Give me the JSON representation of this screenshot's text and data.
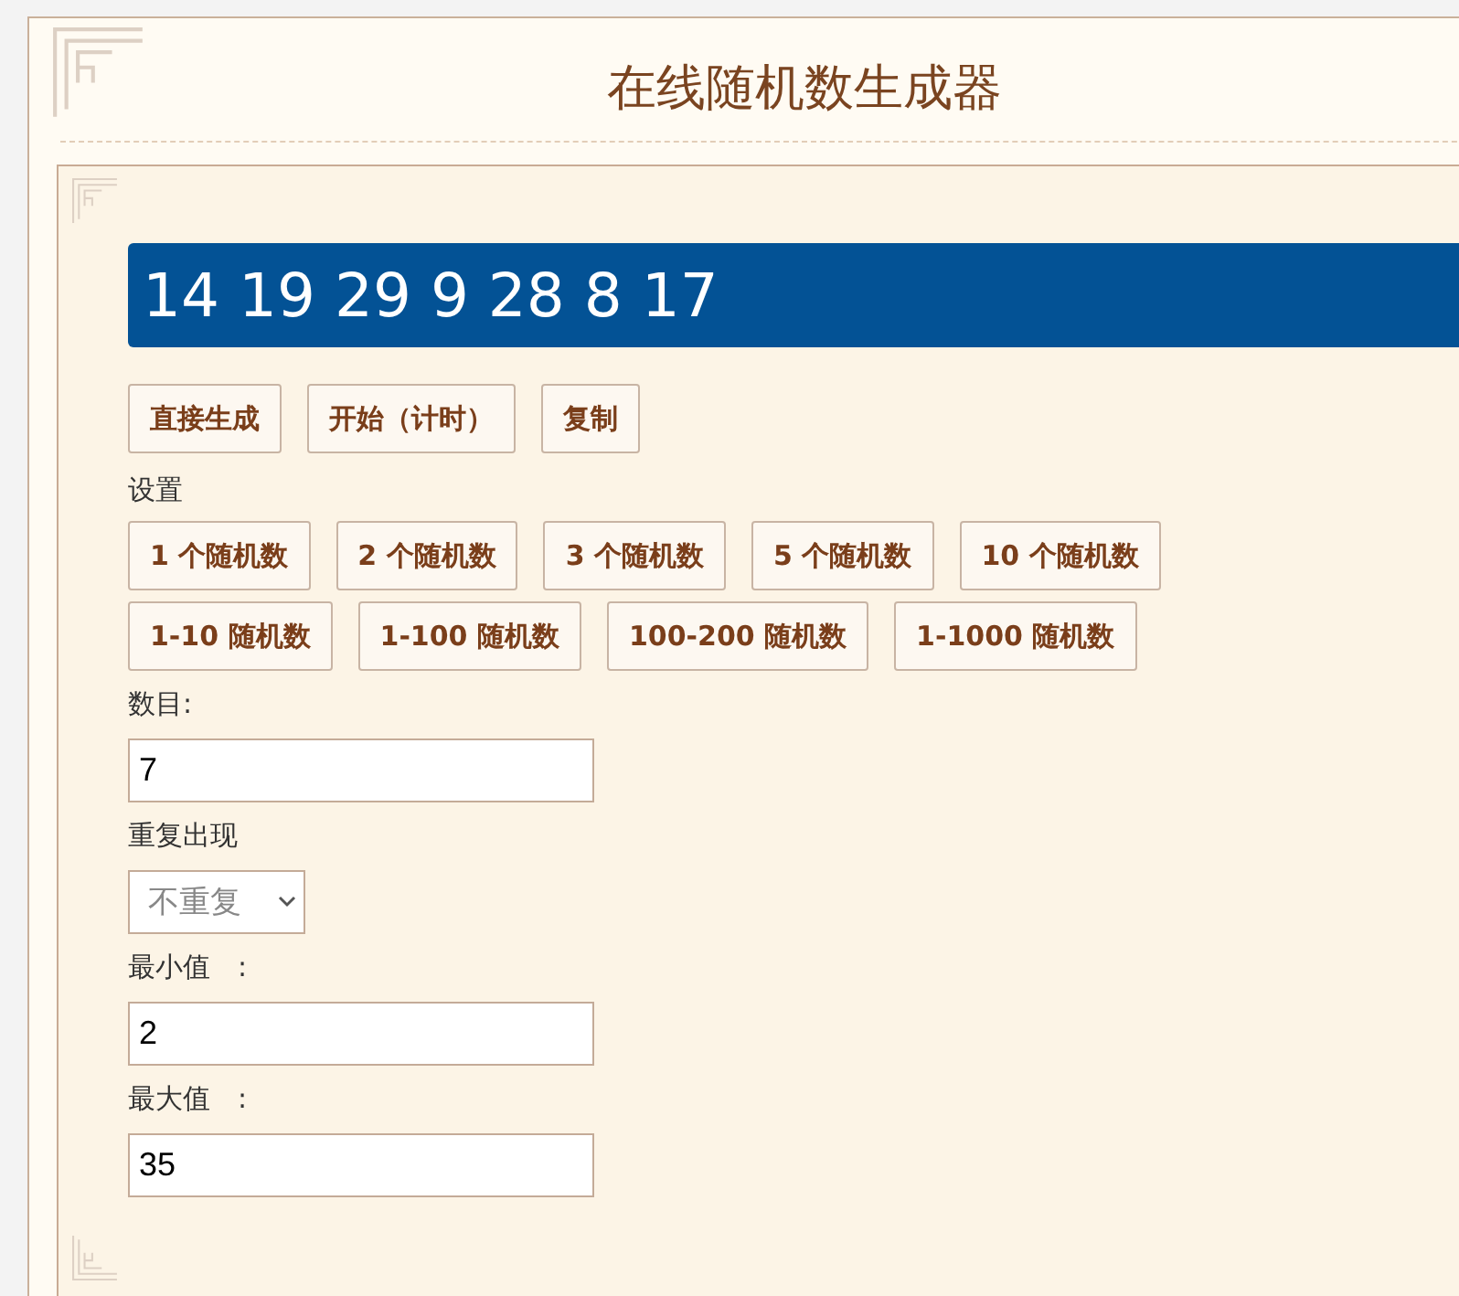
{
  "title": "在线随机数生成器",
  "result": "14 19 29 9 28 8 17",
  "actions": [
    "直接生成",
    "开始（计时）",
    "复制"
  ],
  "settings_label": "设置",
  "preset_rows": [
    [
      "1 个随机数",
      "2 个随机数",
      "3 个随机数",
      "5 个随机数",
      "10 个随机数"
    ],
    [
      "1-10 随机数",
      "1-100 随机数",
      "100-200 随机数",
      "1-1000 随机数"
    ]
  ],
  "fields": [
    {
      "kind": "text",
      "label": "数目:",
      "value": "7"
    },
    {
      "kind": "select",
      "label": "重复出现",
      "value": "不重复"
    },
    {
      "kind": "text",
      "label": "最小值　:",
      "value": "2"
    },
    {
      "kind": "text",
      "label": "最大值　:",
      "value": "35"
    }
  ]
}
